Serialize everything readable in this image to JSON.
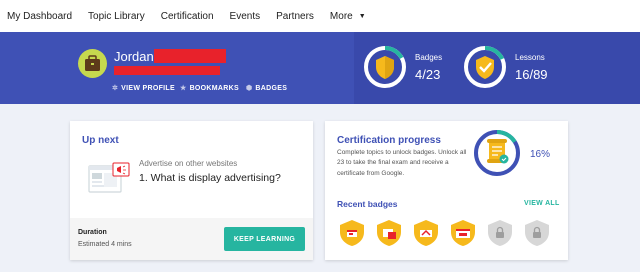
{
  "nav": {
    "items": [
      "My Dashboard",
      "Topic Library",
      "Certification",
      "Events",
      "Partners"
    ],
    "more_label": "More"
  },
  "profile": {
    "name": "Jordan",
    "links": [
      {
        "label": "VIEW PROFILE",
        "icon": "gear-icon"
      },
      {
        "label": "BOOKMARKS",
        "icon": "star-icon"
      },
      {
        "label": "BADGES",
        "icon": "shield-icon"
      }
    ]
  },
  "stats": {
    "badges": {
      "label": "Badges",
      "value": "4/23",
      "progress": 0.17
    },
    "lessons": {
      "label": "Lessons",
      "value": "16/89",
      "progress": 0.18
    }
  },
  "up_next": {
    "title": "Up next",
    "subtitle": "Advertise on other websites",
    "topic": "1. What is display advertising?",
    "duration_label": "Duration",
    "duration_value": "Estimated 4 mins",
    "button_label": "KEEP LEARNING"
  },
  "certification": {
    "title": "Certification progress",
    "description": "Complete topics to unlock badges. Unlock all 23 to take the final exam and receive a certificate from Google.",
    "percent": "16%",
    "progress": 0.16,
    "recent_title": "Recent badges",
    "view_all_label": "VIEW ALL",
    "badges": [
      "earned",
      "earned",
      "earned",
      "earned",
      "locked",
      "locked"
    ]
  },
  "colors": {
    "primary": "#3f51b5",
    "accent": "#26b5a0",
    "badge_gold": "#f6b91c",
    "locked_gray": "#d7d7d7"
  }
}
